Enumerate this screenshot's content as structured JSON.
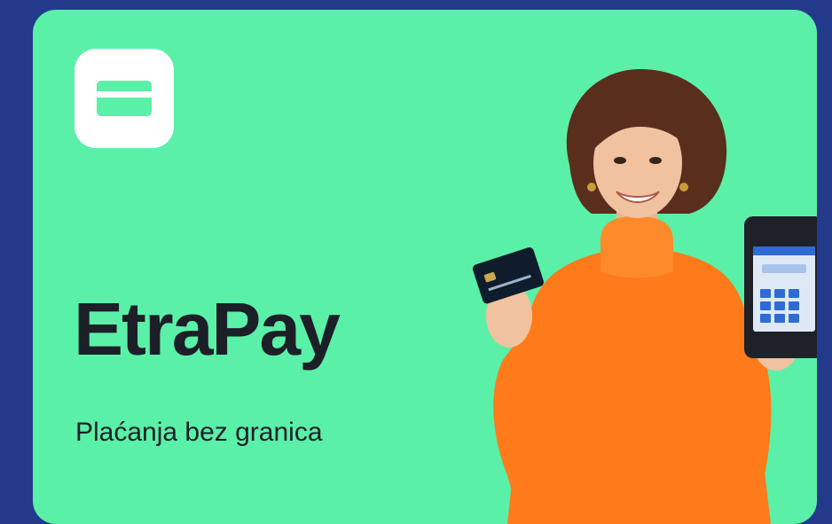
{
  "brand": {
    "title": "EtraPay",
    "tagline": "Plaćanja bez granica"
  },
  "icons": {
    "app_icon": "credit-card-icon"
  },
  "photo": {
    "subject": "woman-holding-card-and-pos-terminal"
  },
  "colors": {
    "background": "#233a8a",
    "card": "#5af0a8",
    "text": "#1c1f27",
    "sweater": "#ff7a1a"
  }
}
